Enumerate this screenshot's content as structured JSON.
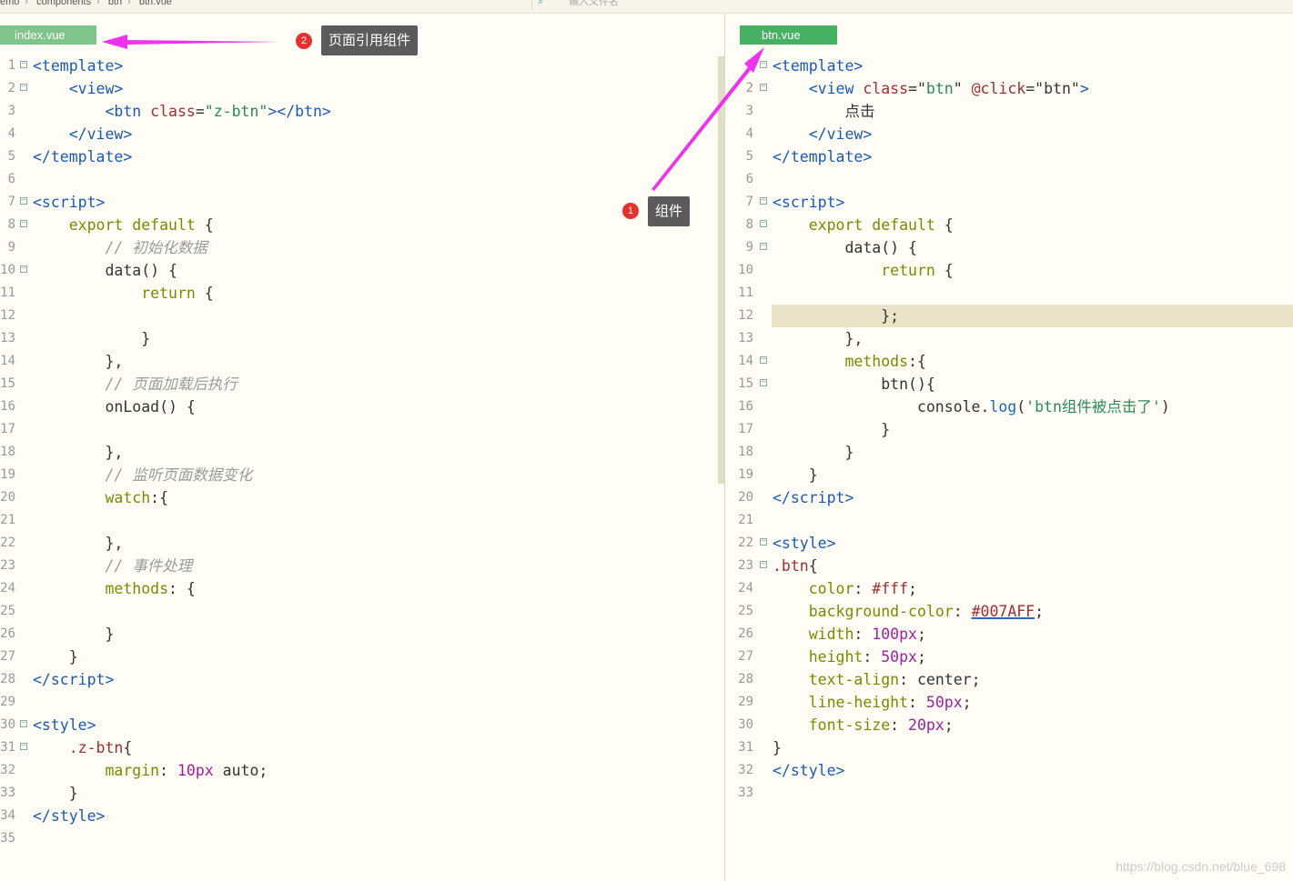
{
  "breadcrumb": [
    "emo",
    "components",
    "btn",
    "btn.vue"
  ],
  "search": {
    "placeholder": "输入文件名"
  },
  "left_tab": "index.vue",
  "right_tab": "btn.vue",
  "annotations": {
    "badge_1": "1",
    "label_1": "组件",
    "badge_2": "2",
    "label_2": "页面引用组件"
  },
  "watermark": "https://blog.csdn.net/blue_698",
  "colors": {
    "tab_active": "#46b063",
    "arrow": "#ee33ee",
    "badge": "#e53030"
  }
}
